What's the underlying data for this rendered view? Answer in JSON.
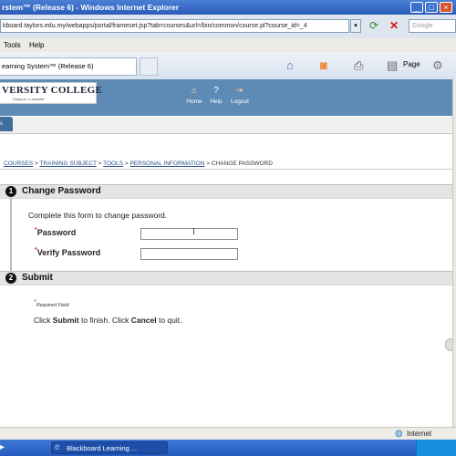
{
  "window": {
    "title": "rstem™ (Release 6) - Windows Internet Explorer"
  },
  "browser": {
    "address": "kboard.taylors.edu.my/webapps/portal/frameset.jsp?tab=courses&url=/bin/common/course.pl?course_id=_4",
    "search_placeholder": "Google",
    "menu": [
      "Tools",
      "Help"
    ],
    "tab_title": "earning System™ (Release 6)",
    "toolbar": {
      "page_label": "Page"
    },
    "status_zone": "Internet"
  },
  "site": {
    "logo_text": "VERSITY COLLEGE",
    "logo_sub": "Kampus • Lakeside",
    "nav": [
      {
        "label": "Home",
        "icon": "home-icon"
      },
      {
        "label": "Help",
        "icon": "help-icon"
      },
      {
        "label": "Logout",
        "icon": "logout-icon"
      }
    ],
    "subtab_label": "s"
  },
  "breadcrumb": {
    "items": [
      "COURSES",
      "TRAINING SUBJECT",
      "TOOLS",
      "PERSONAL INFORMATION"
    ],
    "current": "CHANGE PASSWORD"
  },
  "form": {
    "section1": {
      "number": "1",
      "title": "Change Password",
      "instruction": "Complete this form to change password.",
      "password_label": "Password",
      "verify_label": "Verify Password"
    },
    "section2": {
      "number": "2",
      "title": "Submit",
      "required_note": "Required Field",
      "text_prefix": "Click ",
      "submit_word": "Submit",
      "text_mid": " to finish. Click ",
      "cancel_word": "Cancel",
      "text_suffix": " to quit."
    },
    "required_marker": "*"
  },
  "taskbar": {
    "ie_task": "Blackboard Learning ..."
  },
  "colors": {
    "banner": "#5e8bb6",
    "titlebar": "#2a5cb8",
    "taskbar": "#245bc0"
  }
}
